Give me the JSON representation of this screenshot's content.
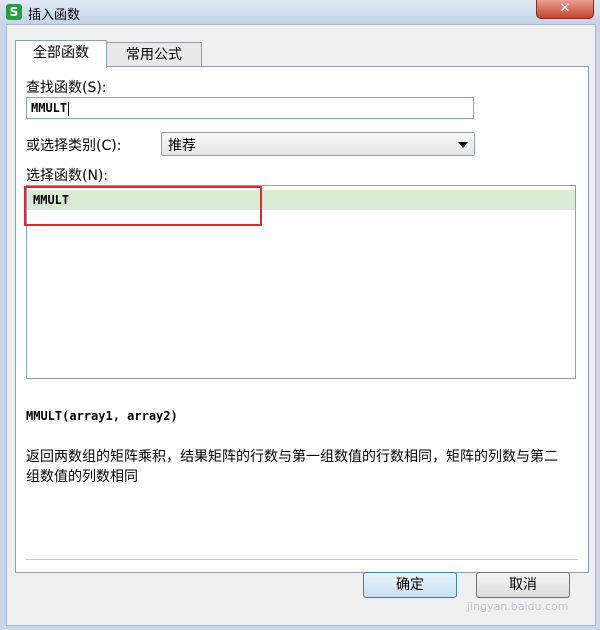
{
  "window": {
    "title": "插入函数",
    "app_icon_glyph": "S",
    "close_glyph": "✕"
  },
  "tabs": [
    {
      "label": "全部函数",
      "active": true
    },
    {
      "label": "常用公式",
      "active": false
    }
  ],
  "search": {
    "label": "查找函数(S):",
    "value": "MMULT"
  },
  "category": {
    "label": "或选择类别(C):",
    "selected": "推荐"
  },
  "functions": {
    "label": "选择函数(N):",
    "items": [
      {
        "name": "MMULT",
        "selected": true
      }
    ]
  },
  "detail": {
    "signature": "MMULT(array1, array2)",
    "description": "返回两数组的矩阵乘积，结果矩阵的行数与第一组数值的行数相同，矩阵的列数与第二组数值的列数相同"
  },
  "buttons": {
    "ok_label": "确定",
    "cancel_label": "取消"
  },
  "watermark": "jingyan.baidu.com",
  "colors": {
    "selection": "#d9ecd4",
    "highlight_box": "#e0292e",
    "close_button": "#c7432f",
    "app_icon": "#27a043"
  }
}
